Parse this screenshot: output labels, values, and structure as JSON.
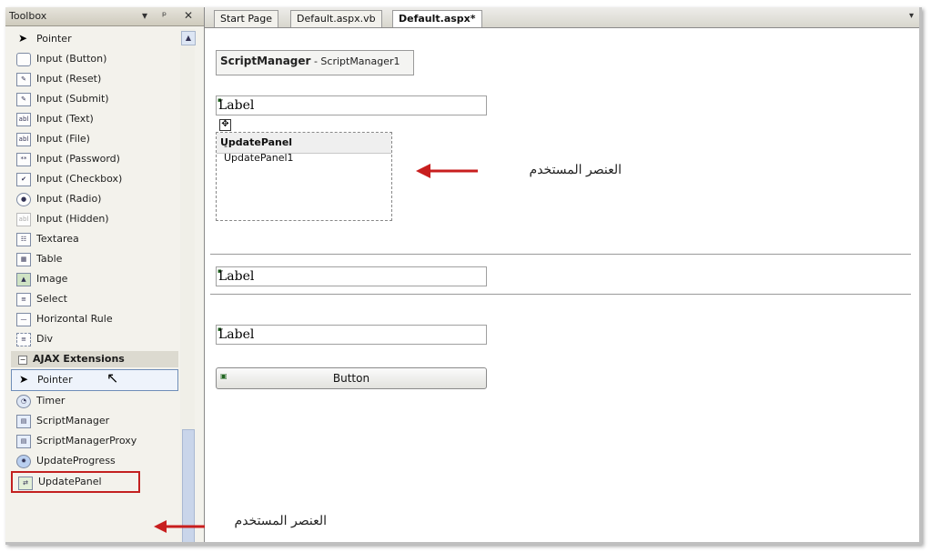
{
  "toolbox": {
    "title": "Toolbox",
    "controls": [
      "▾",
      "ᵖ",
      "✕"
    ],
    "html_items": [
      {
        "label": "Pointer",
        "icon": "pointer-arrow-icon"
      },
      {
        "label": "Input (Button)",
        "icon": "input-button-icon"
      },
      {
        "label": "Input (Reset)",
        "icon": "input-reset-icon"
      },
      {
        "label": "Input (Submit)",
        "icon": "input-submit-icon"
      },
      {
        "label": "Input (Text)",
        "icon": "input-text-icon"
      },
      {
        "label": "Input (File)",
        "icon": "input-file-icon"
      },
      {
        "label": "Input (Password)",
        "icon": "input-password-icon"
      },
      {
        "label": "Input (Checkbox)",
        "icon": "checkbox-icon"
      },
      {
        "label": "Input (Radio)",
        "icon": "radio-icon"
      },
      {
        "label": "Input (Hidden)",
        "icon": "input-hidden-icon"
      },
      {
        "label": "Textarea",
        "icon": "textarea-icon"
      },
      {
        "label": "Table",
        "icon": "table-icon"
      },
      {
        "label": "Image",
        "icon": "image-icon"
      },
      {
        "label": "Select",
        "icon": "select-icon"
      },
      {
        "label": "Horizontal Rule",
        "icon": "horizontal-rule-icon"
      },
      {
        "label": "Div",
        "icon": "div-icon"
      }
    ],
    "ajax_group": "AJAX Extensions",
    "ajax_items": [
      {
        "label": "Pointer",
        "icon": "pointer-arrow-icon"
      },
      {
        "label": "Timer",
        "icon": "timer-icon"
      },
      {
        "label": "ScriptManager",
        "icon": "scriptmanager-icon"
      },
      {
        "label": "ScriptManagerProxy",
        "icon": "scriptmanagerproxy-icon"
      },
      {
        "label": "UpdateProgress",
        "icon": "updateprogress-icon"
      },
      {
        "label": "UpdatePanel",
        "icon": "updatepanel-icon"
      }
    ]
  },
  "tabs": [
    {
      "label": "Start Page"
    },
    {
      "label": "Default.aspx.vb"
    },
    {
      "label": "Default.aspx*"
    }
  ],
  "designer": {
    "script_manager_type": "ScriptManager",
    "script_manager_id": " - ScriptManager1",
    "label_text": "Label",
    "update_panel_type": "UpdatePanel",
    "update_panel_id": " - UpdatePanel1",
    "button_text": "Button"
  },
  "annotations": {
    "panel_note": "العنصر المستخدم",
    "toolbox_note": "العنصر المستخدم"
  },
  "colors": {
    "arrow": "#c81e1e",
    "highlight_box": "#c32020"
  }
}
